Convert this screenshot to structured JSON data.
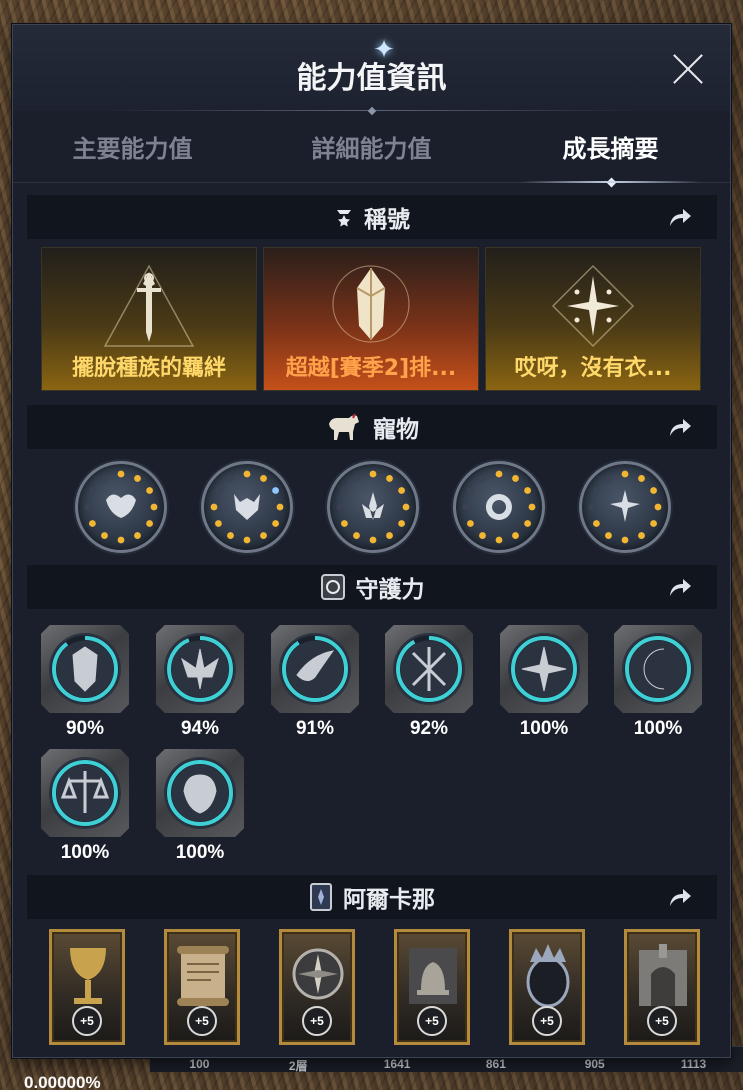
{
  "window": {
    "title": "能力值資訊",
    "close_icon": "close-icon"
  },
  "tabs": [
    {
      "label": "主要能力值",
      "active": false
    },
    {
      "label": "詳細能力值",
      "active": false
    },
    {
      "label": "成長摘要",
      "active": true
    }
  ],
  "sections": {
    "titles": {
      "label": "稱號",
      "icon": "title-badge-icon",
      "cards": [
        {
          "label": "擺脫種族的羈絆",
          "style": "gold",
          "icon": "sword-triangle-icon"
        },
        {
          "label": "超越[賽季2]排...",
          "style": "orange",
          "icon": "shield-crest-icon"
        },
        {
          "label": "哎呀，沒有衣...",
          "style": "gold",
          "icon": "sparkle-diamond-icon"
        }
      ]
    },
    "pets": {
      "label": "寵物",
      "icon": "horse-icon",
      "items": [
        {
          "icon": "owl-mask-icon"
        },
        {
          "icon": "wolf-head-icon"
        },
        {
          "icon": "lotus-icon"
        },
        {
          "icon": "vortex-sun-icon"
        },
        {
          "icon": "star-flower-icon"
        }
      ]
    },
    "guardian": {
      "label": "守護力",
      "icon": "guardian-crest-icon",
      "items": [
        {
          "percent": "90%",
          "progress": 0.9,
          "icon": "shield-emblem-icon"
        },
        {
          "percent": "94%",
          "progress": 0.94,
          "icon": "winged-crest-icon"
        },
        {
          "percent": "91%",
          "progress": 0.91,
          "icon": "phoenix-icon"
        },
        {
          "percent": "92%",
          "progress": 0.92,
          "icon": "crossed-blades-icon"
        },
        {
          "percent": "100%",
          "progress": 1.0,
          "icon": "compass-star-icon"
        },
        {
          "percent": "100%",
          "progress": 1.0,
          "icon": "crescent-moon-icon"
        },
        {
          "percent": "100%",
          "progress": 1.0,
          "icon": "scales-icon"
        },
        {
          "percent": "100%",
          "progress": 1.0,
          "icon": "tree-crest-icon"
        }
      ]
    },
    "arcana": {
      "label": "阿爾卡那",
      "icon": "arcana-card-icon",
      "items": [
        {
          "badge": "+5",
          "icon": "chalice-icon"
        },
        {
          "badge": "+5",
          "icon": "scroll-icon"
        },
        {
          "badge": "+5",
          "icon": "compass-icon"
        },
        {
          "badge": "+5",
          "icon": "bell-tower-icon"
        },
        {
          "badge": "+5",
          "icon": "mirror-crown-icon"
        },
        {
          "badge": "+5",
          "icon": "gate-icon"
        }
      ]
    }
  },
  "background": {
    "strip_values": [
      "100",
      "2層",
      "1641",
      "861",
      "905",
      "1113"
    ],
    "percent_text": "0.00000%"
  },
  "colors": {
    "panel_bg": "#1a1f2b",
    "section_header_bg": "#11151d",
    "title_card_gold_text": "#ffd86a",
    "title_card_orange_text": "#ffa24a",
    "guardian_ring": "#3fd0d6",
    "pet_dot": "#f2b632",
    "arcana_frame": "#b48a3c"
  }
}
